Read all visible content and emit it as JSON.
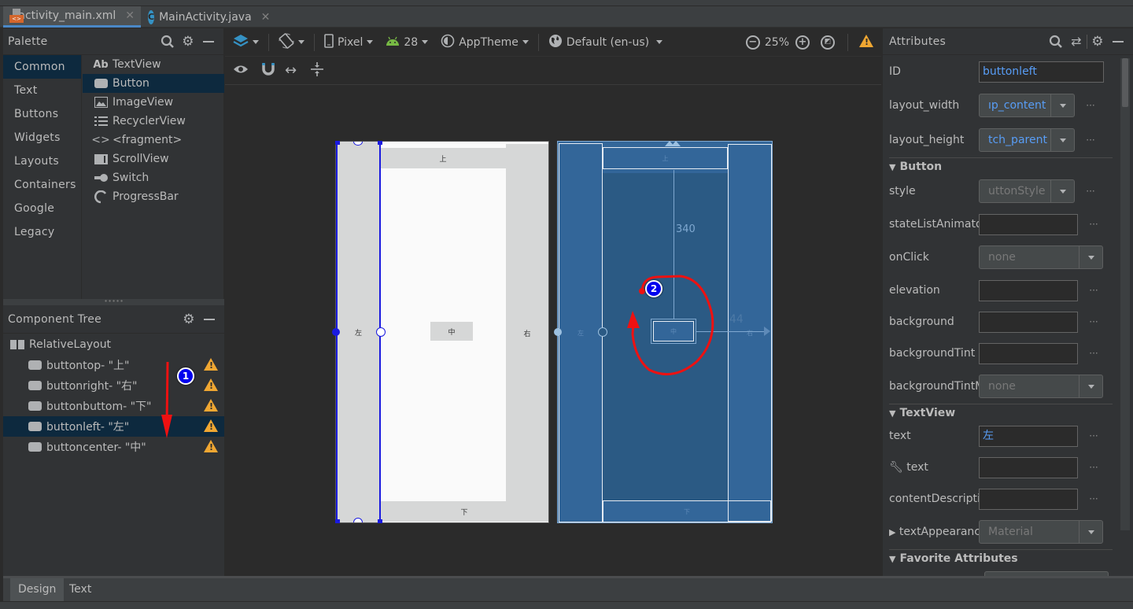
{
  "file_tabs": [
    {
      "label": "activity_main.xml",
      "icon": "xml-layout-icon",
      "active": true
    },
    {
      "label": "MainActivity.java",
      "icon": "java-class-icon",
      "active": false
    }
  ],
  "palette": {
    "title": "Palette",
    "categories": [
      "Common",
      "Text",
      "Buttons",
      "Widgets",
      "Layouts",
      "Containers",
      "Google",
      "Legacy"
    ],
    "selected_category": "Common",
    "items": [
      {
        "label": "TextView",
        "icon": "Ab"
      },
      {
        "label": "Button",
        "icon": "button-icon"
      },
      {
        "label": "ImageView",
        "icon": "image-icon"
      },
      {
        "label": "RecyclerView",
        "icon": "list-icon"
      },
      {
        "label": "<fragment>",
        "icon": "code-icon"
      },
      {
        "label": "ScrollView",
        "icon": "scroll-icon"
      },
      {
        "label": "Switch",
        "icon": "switch-icon"
      },
      {
        "label": "ProgressBar",
        "icon": "progress-icon"
      }
    ],
    "selected_item": "Button"
  },
  "component_tree": {
    "title": "Component Tree",
    "root": "RelativeLayout",
    "nodes": [
      {
        "label": "buttontop- \"上\"",
        "warning": true
      },
      {
        "label": "buttonright- \"右\"",
        "warning": true
      },
      {
        "label": "buttonbuttom- \"下\"",
        "warning": true
      },
      {
        "label": "buttonleft- \"左\"",
        "warning": true,
        "selected": true
      },
      {
        "label": "buttoncenter- \"中\"",
        "warning": true
      }
    ]
  },
  "toolbar": {
    "device": "Pixel",
    "api_level": "28",
    "theme": "AppTheme",
    "locale": "Default (en-us)",
    "zoom": "25%"
  },
  "design_preview": {
    "buttons": {
      "top": "上",
      "left": "左",
      "center": "中",
      "right": "右",
      "bottom": "下"
    }
  },
  "blueprint": {
    "dimension_vertical": "340",
    "dimension_horizontal": "44",
    "buttons": {
      "top": "上",
      "left": "左",
      "center": "中",
      "right": "右",
      "bottom": "下"
    }
  },
  "annotations": {
    "badge1": "1",
    "badge2": "2"
  },
  "attributes": {
    "title": "Attributes",
    "id_label": "ID",
    "id_value": "buttonleft",
    "layout_width_label": "layout_width",
    "layout_width_value": "ıp_content",
    "layout_height_label": "layout_height",
    "layout_height_value": "tch_parent",
    "section_button": "Button",
    "style_label": "style",
    "style_value": "uttonStyle",
    "state_list_label": "stateListAnimato",
    "onclick_label": "onClick",
    "onclick_value": "none",
    "elevation_label": "elevation",
    "background_label": "background",
    "background_tint_label": "backgroundTint",
    "background_tint_mode_label": "backgroundTintM",
    "background_tint_mode_value": "none",
    "section_textview": "TextView",
    "text_label": "text",
    "text_value": "左",
    "tools_text_label": "text",
    "content_desc_label": "contentDescriptio",
    "text_appearance_label": "textAppearanc",
    "text_appearance_value": "Material",
    "section_favorites": "Favorite Attributes",
    "more_label": "···"
  },
  "bottom_tabs": [
    {
      "label": "Design",
      "active": true
    },
    {
      "label": "Text",
      "active": false
    }
  ]
}
